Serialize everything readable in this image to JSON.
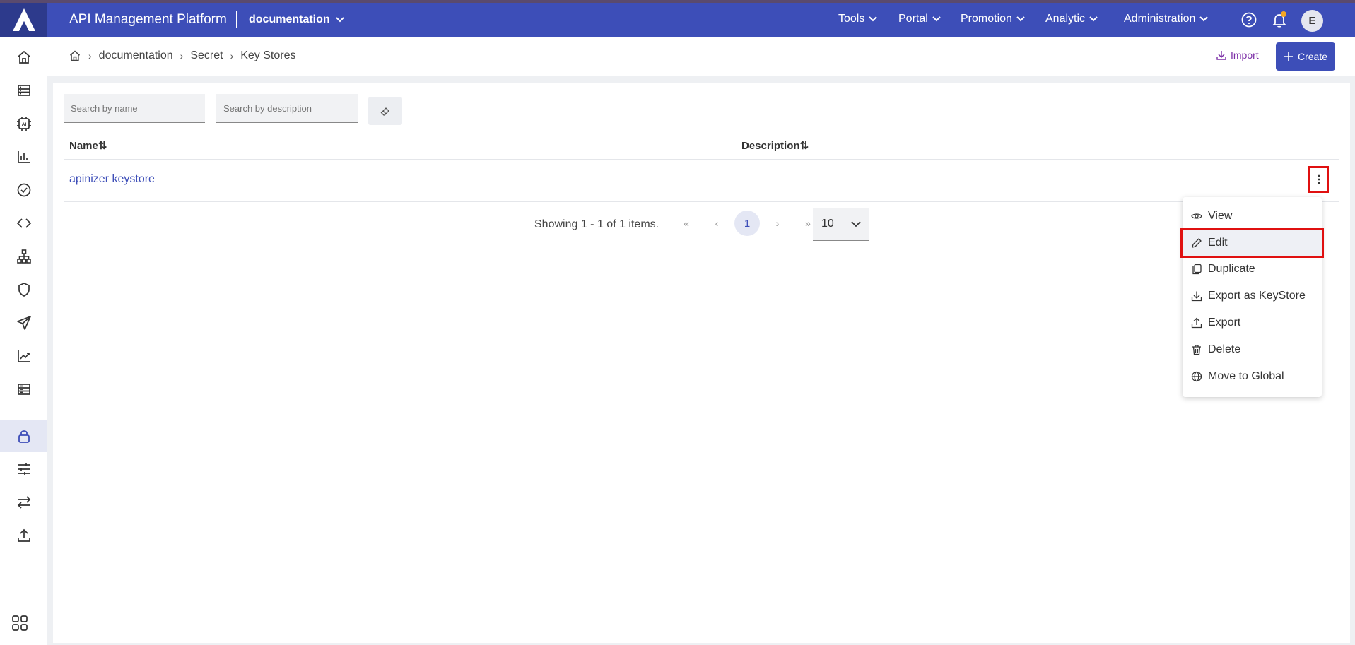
{
  "header": {
    "app_title": "API Management Platform",
    "project": "documentation",
    "nav": [
      "Tools",
      "Portal",
      "Promotion",
      "Analytic",
      "Administration"
    ],
    "avatar_initial": "E",
    "colors": {
      "topbar": "#3d4eb8",
      "accent_orange": "#f5a623",
      "highlight_red": "#e01010"
    }
  },
  "sidebar": {
    "items": [
      "home-icon",
      "list-icon",
      "ai-chip-icon",
      "bar-chart-icon",
      "check-circle-icon",
      "code-icon",
      "hierarchy-icon",
      "shield-icon",
      "send-icon",
      "trend-icon",
      "server-icon",
      "lock-icon",
      "sliders-icon",
      "transfer-icon",
      "upload-icon"
    ],
    "active": "lock-icon",
    "bottom": "apps-grid-icon"
  },
  "breadcrumb": [
    "documentation",
    "Secret",
    "Key Stores"
  ],
  "toolbar": {
    "import_label": "Import",
    "create_label": "Create"
  },
  "filters": {
    "name_placeholder": "Search by name",
    "description_placeholder": "Search by description"
  },
  "table": {
    "columns": [
      "Name",
      "Description"
    ],
    "rows": [
      {
        "name": "apinizer keystore",
        "description": ""
      }
    ]
  },
  "pagination": {
    "summary": "Showing 1 - 1 of 1 items.",
    "current_page": "1",
    "page_size": "10"
  },
  "context_menu": {
    "items": [
      "View",
      "Edit",
      "Duplicate",
      "Export as KeyStore",
      "Export",
      "Delete",
      "Move to Global"
    ],
    "highlighted": "Edit"
  }
}
